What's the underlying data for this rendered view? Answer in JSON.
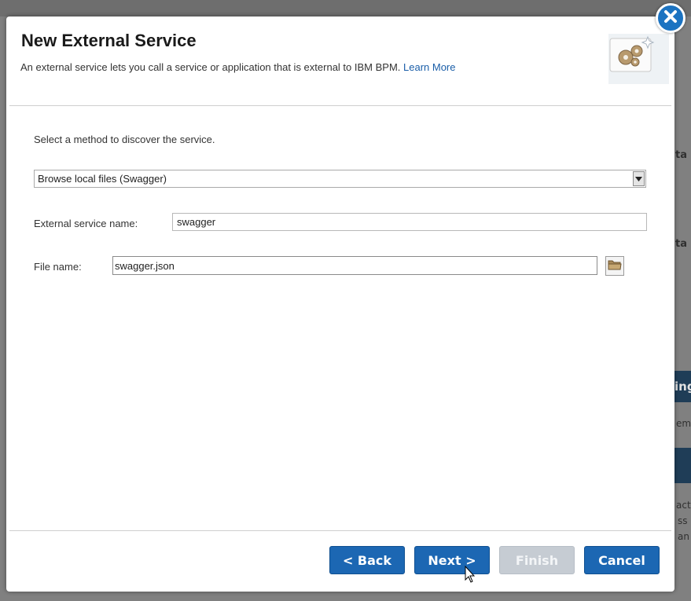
{
  "background": {
    "fragments": [
      "ta",
      "ta",
      "ing",
      "em",
      "act",
      "ss",
      "an"
    ]
  },
  "dialog": {
    "title": "New External Service",
    "subtitle": "An external service lets you call a service or application that is external to IBM BPM.",
    "learn_more": "Learn More",
    "header_icon": "gears-icon"
  },
  "form": {
    "method_label": "Select a method to discover the service.",
    "method_selected": "Browse local files (Swagger)",
    "service_name_label": "External service name:",
    "service_name_value": "swagger",
    "file_name_label": "File name:",
    "file_name_value": "swagger.json"
  },
  "buttons": {
    "back": "< Back",
    "next": "Next >",
    "finish": "Finish",
    "cancel": "Cancel"
  },
  "colors": {
    "primary": "#1c67b3",
    "disabled": "#c6ccd3",
    "close": "#1c73c1",
    "link": "#1a5ea8"
  }
}
